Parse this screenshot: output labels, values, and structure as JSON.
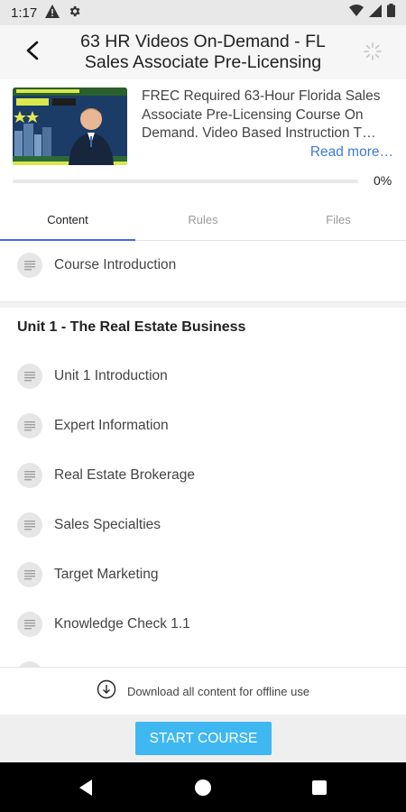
{
  "status_bar": {
    "time": "1:17",
    "icons": [
      "alert-icon",
      "settings-icon",
      "wifi-icon",
      "signal-icon",
      "battery-icon"
    ]
  },
  "header": {
    "title": "63 HR Videos On-Demand - FL Sales Associate Pre-Licensing",
    "back_icon": "arrow-back-icon",
    "loading_icon": "spinner-icon"
  },
  "course": {
    "description": "FREC Required 63-Hour Florida Sales Associate Pre-Licensing Course On Demand. Video Based Instruction T…",
    "read_more": "Read more…",
    "progress": 0,
    "progress_label": "0%"
  },
  "tabs": [
    {
      "label": "Content",
      "active": true
    },
    {
      "label": "Rules",
      "active": false
    },
    {
      "label": "Files",
      "active": false
    }
  ],
  "content": {
    "intro_items": [
      {
        "label": "Course Introduction",
        "icon": "document-icon"
      }
    ],
    "units": [
      {
        "title": "Unit 1 - The Real Estate Business",
        "items": [
          {
            "label": "Unit 1 Introduction",
            "icon": "document-icon"
          },
          {
            "label": "Expert Information",
            "icon": "document-icon"
          },
          {
            "label": "Real Estate Brokerage",
            "icon": "document-icon"
          },
          {
            "label": "Sales Specialties",
            "icon": "document-icon"
          },
          {
            "label": "Target Marketing",
            "icon": "document-icon"
          },
          {
            "label": "Knowledge Check 1.1",
            "icon": "document-icon"
          }
        ]
      }
    ]
  },
  "download": {
    "label": "Download all content for offline use",
    "icon": "download-icon"
  },
  "footer": {
    "start_button": "START COURSE",
    "accent_color": "#3fb8f2"
  },
  "nav_bar": {
    "icons": [
      "back-triangle-icon",
      "home-circle-icon",
      "recents-square-icon"
    ]
  },
  "colors": {
    "tab_indicator": "#3b6fe0",
    "link": "#3f7ad8",
    "header_bg": "#f6f6f6"
  }
}
